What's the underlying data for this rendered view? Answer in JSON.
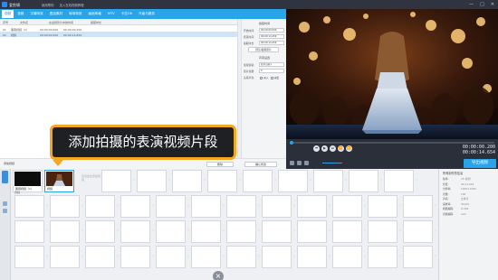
{
  "window": {
    "app_name": "爱剪辑",
    "menu": [
      "使用帮助",
      "加入在线视频教程"
    ],
    "buttons": [
      "—",
      "□",
      "✕"
    ]
  },
  "tabs": [
    {
      "label": "视频",
      "active": true
    },
    {
      "label": "音频",
      "active": false
    },
    {
      "label": "字幕特效",
      "active": false
    },
    {
      "label": "叠加素材",
      "active": false
    },
    {
      "label": "转场特效",
      "active": false
    },
    {
      "label": "画面风格",
      "active": false
    },
    {
      "label": "MTV",
      "active": false
    },
    {
      "label": "卡拉OK",
      "active": false
    },
    {
      "label": "升级与服务",
      "active": false
    }
  ],
  "video_list": {
    "headers": [
      "序号",
      "文件名",
      "在最终影片中的时间",
      "截取时长"
    ],
    "rows": [
      {
        "index": "01",
        "name": "黑幕视频（1）",
        "start": "00:00:00.000",
        "end": "00:00:00.200",
        "selected": false
      },
      {
        "index": "02",
        "name": "视频",
        "start": "00:00:00.200",
        "end": "00:00:14.654",
        "selected": true
      }
    ]
  },
  "properties": {
    "trim_title": "截取时间",
    "start_label": "开始时间:",
    "start_value": "00:00:00.000",
    "end_label": "结束时间:",
    "end_value": "00:00:14.454",
    "duration_label": "截取时长:",
    "duration_value": "00:00:14.454",
    "preview_trim_button": "预览/截取原片",
    "audio_title": "声音设置",
    "track_label": "使用音轨:",
    "track_value": "原片音轨1",
    "volume_label": "原片音量:",
    "volume_value": "0",
    "fade_label": "头尾声音:",
    "fade_in": "淡入",
    "fade_out": "淡出"
  },
  "midbar": {
    "add_video": "添加视频",
    "delete": "删除",
    "confirm": "确认修改"
  },
  "callout": {
    "text": "添加拍摄的表演视频片段"
  },
  "player": {
    "timecode_current": "00:00:00.200",
    "timecode_total": "00:00:14.654",
    "volume_level": 0.68,
    "buttons": [
      "⏮",
      "▶",
      "⏭",
      "⏪",
      "⏩"
    ]
  },
  "export": {
    "label": "导出视频"
  },
  "timeline": {
    "side_label": "已添加片段",
    "clips": [
      {
        "name": "黑幕视频（1）",
        "selected": false
      },
      {
        "name": "视频",
        "selected": true
      }
    ],
    "hint": "双击此处添加视频",
    "footer_label": "音频"
  },
  "info_panel": {
    "title": "所有制作的信息",
    "rows": [
      {
        "label": "帧率:",
        "value": "25 帧/秒"
      },
      {
        "label": "长度:",
        "value": "00:14.654"
      },
      {
        "label": "分辨率:",
        "value": "1920×1080"
      },
      {
        "label": "音量:",
        "value": "100"
      },
      {
        "label": "声道:",
        "value": "立体声"
      },
      {
        "label": "采样率:",
        "value": "44100"
      },
      {
        "label": "视频编码:",
        "value": "H.264"
      },
      {
        "label": "音频编码:",
        "value": "AAC"
      }
    ]
  },
  "colors": {
    "accent": "#2aa4e8",
    "callout_border": "#f5a623",
    "callout_fill": "#1f2024",
    "titlebar": "#2f3440"
  }
}
